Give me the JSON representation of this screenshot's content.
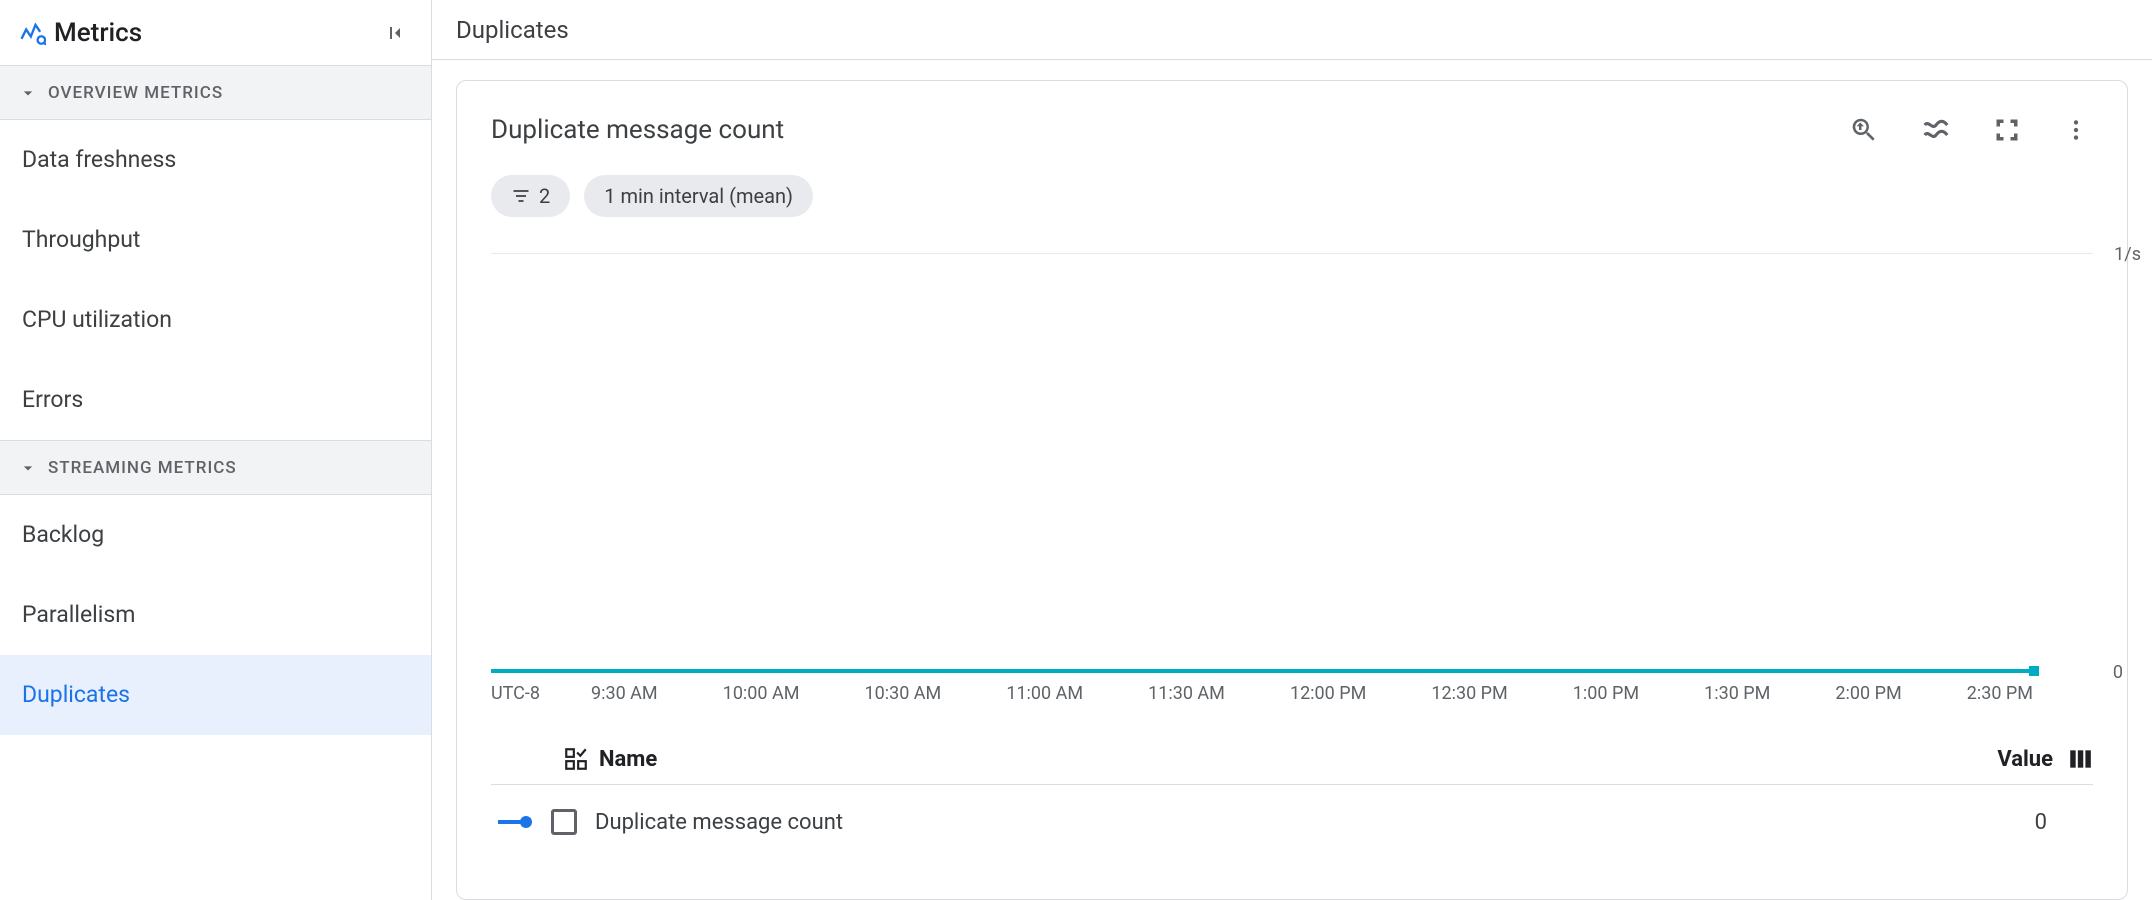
{
  "sidebar": {
    "title": "Metrics",
    "sections": [
      {
        "label": "OVERVIEW METRICS",
        "items": [
          "Data freshness",
          "Throughput",
          "CPU utilization",
          "Errors"
        ]
      },
      {
        "label": "STREAMING METRICS",
        "items": [
          "Backlog",
          "Parallelism",
          "Duplicates"
        ]
      }
    ],
    "active": "Duplicates"
  },
  "header": {
    "title": "Duplicates"
  },
  "card": {
    "title": "Duplicate message count",
    "filter_count": "2",
    "interval": "1 min interval (mean)"
  },
  "chart_data": {
    "type": "line",
    "title": "Duplicate message count",
    "y_unit": "1/s",
    "timezone": "UTC-8",
    "x_ticks": [
      "9:30 AM",
      "10:00 AM",
      "10:30 AM",
      "11:00 AM",
      "11:30 AM",
      "12:00 PM",
      "12:30 PM",
      "1:00 PM",
      "1:30 PM",
      "2:00 PM",
      "2:30 PM"
    ],
    "series": [
      {
        "name": "Duplicate message count",
        "color": "#00acc1",
        "values": [
          0,
          0,
          0,
          0,
          0,
          0,
          0,
          0,
          0,
          0,
          0
        ],
        "current_value": 0
      }
    ],
    "ylim": [
      0,
      1
    ],
    "baseline_value": "0"
  },
  "table": {
    "col_name": "Name",
    "col_value": "Value",
    "rows": [
      {
        "name": "Duplicate message count",
        "value": "0",
        "checked": false
      }
    ]
  }
}
